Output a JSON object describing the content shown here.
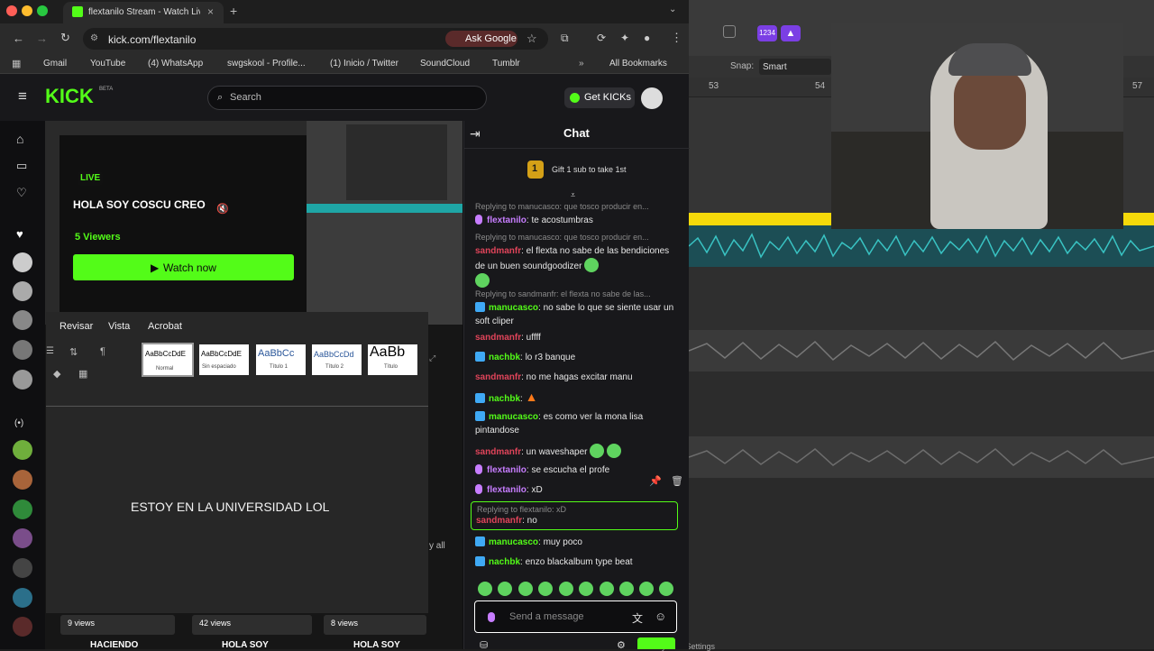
{
  "browser": {
    "tab_title": "flextanilo Stream - Watch Live",
    "new_tab_icon": "plus-icon",
    "url": "kick.com/flextanilo",
    "ask_google": "Ask Google",
    "bookmarks": [
      "Gmail",
      "YouTube",
      "(4) WhatsApp",
      "swgskool - Profile...",
      "(1) Inicio / Twitter",
      "SoundCloud",
      "Tumblr"
    ],
    "all_bookmarks": "All Bookmarks"
  },
  "kick": {
    "logo": "KICK",
    "beta": "BETA",
    "search_placeholder": "Search",
    "get_kicks": "Get KICKs",
    "live_badge": "LIVE",
    "stream_title": "HOLA SOY COSCU CREO",
    "viewers": "5 Viewers",
    "watch_now": "Watch now",
    "word_tabs": [
      "Revisar",
      "Vista",
      "Acrobat"
    ],
    "styles": [
      {
        "sample": "AaBbCcDdE",
        "name": "Normal"
      },
      {
        "sample": "AaBbCcDdE",
        "name": "Sin espaciado"
      },
      {
        "sample": "AaBbCc",
        "name": "Título 1"
      },
      {
        "sample": "AaBbCcDd",
        "name": "Título 2"
      },
      {
        "sample": "AaBb",
        "name": "Título"
      }
    ],
    "doc_text": "ESTOY EN LA UNIVERSIDAD LOL",
    "view_all": "y all",
    "thumbnails": [
      {
        "views": "9 views",
        "title": "HACIENDO"
      },
      {
        "views": "42 views",
        "title": "HOLA SOY"
      },
      {
        "views": "8 views",
        "title": "HOLA SOY"
      }
    ]
  },
  "chat": {
    "title": "Chat",
    "gift_count": "1",
    "gift_text": "Gift 1 sub to take 1st",
    "messages": [
      {
        "reply": "Replying to manucasco: que tosco producir en...",
        "user": "flextanilo",
        "text": ": te acostumbras"
      },
      {
        "reply": "Replying to manucasco: que tosco producir en...",
        "user": "sandmanfr",
        "text": ": el flexta no sabe de las bendiciones de un buen soundgoodizer"
      },
      {
        "reply": "Replying to sandmanfr: el flexta no sabe de las...",
        "user": "manucasco",
        "text": ": no sabe lo que se siente usar un soft cliper"
      },
      {
        "user": "sandmanfr",
        "text": ": uffff"
      },
      {
        "user": "nachbk",
        "text": ": lo r3 banque"
      },
      {
        "user": "sandmanfr",
        "text": ": no me hagas excitar manu"
      },
      {
        "user": "nachbk",
        "text": ":"
      },
      {
        "user": "manucasco",
        "text": ": es como ver la mona lisa pintandose"
      },
      {
        "user": "sandmanfr",
        "text": ": un waveshaper"
      },
      {
        "user": "flextanilo",
        "text": ": se escucha el profe"
      },
      {
        "user": "flextanilo",
        "text": ": xD"
      },
      {
        "reply": "Replying to flextanilo: xD",
        "user": "sandmanfr",
        "text": ": no"
      },
      {
        "user": "manucasco",
        "text": ": muy poco"
      },
      {
        "user": "nachbk",
        "text": ": enzo blackalbum type beat"
      }
    ],
    "placeholder": "Send a message"
  },
  "daw": {
    "snap_label": "Snap:",
    "snap_value": "Smart",
    "counter": "1234",
    "bars": [
      "53",
      "54",
      "57"
    ],
    "system_settings": "System Settings"
  },
  "colors": {
    "kick_green": "#53fc18",
    "yellow_lane": "#f5d90a",
    "teal_wave": "#1fa6a6"
  }
}
